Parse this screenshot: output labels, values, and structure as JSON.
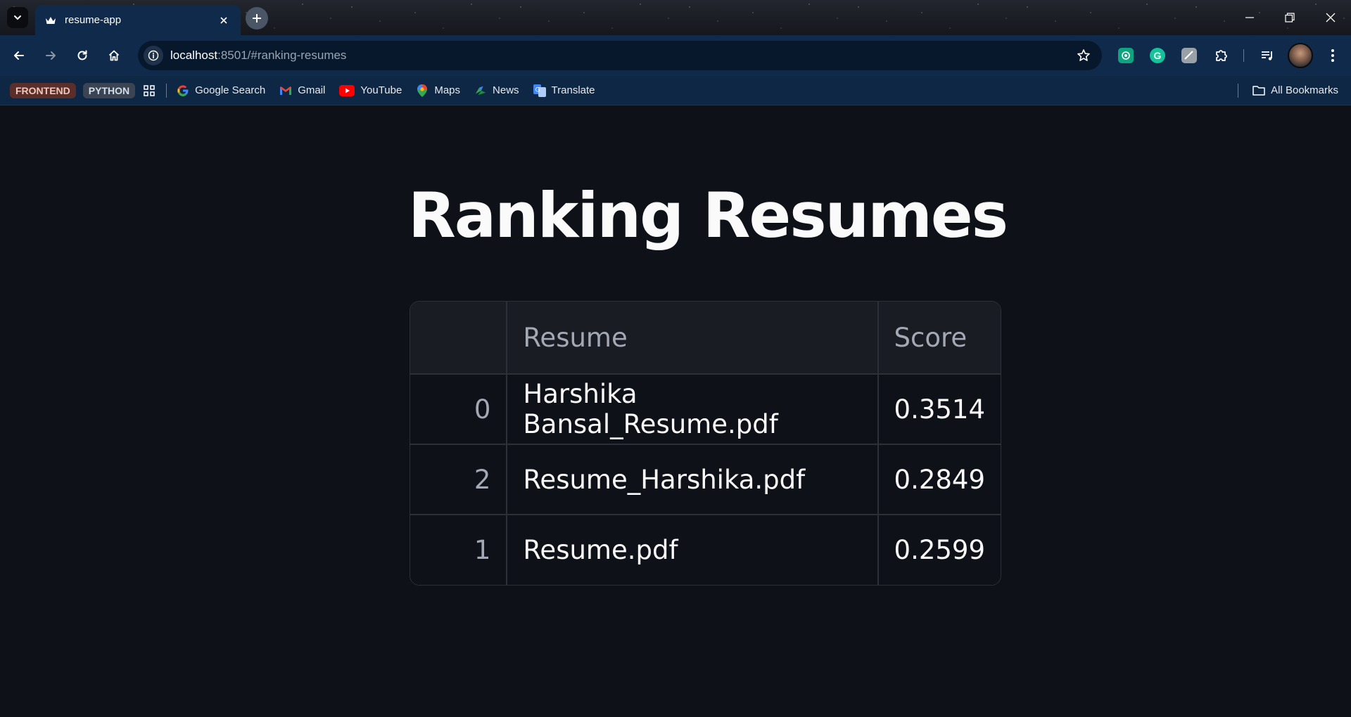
{
  "browser": {
    "tab": {
      "title": "resume-app",
      "favicon": "streamlit-crown-icon"
    },
    "url": {
      "host": "localhost",
      "rest": ":8501/#ranking-resumes"
    },
    "bookmarks": {
      "chips": [
        {
          "label": "FRONTEND",
          "bg": "#5a2e29",
          "color": "#f2c7be"
        },
        {
          "label": "PYTHON",
          "bg": "#3a4452",
          "color": "#d6dde8"
        }
      ],
      "items": [
        {
          "label": "Google Search",
          "icon": "google-icon"
        },
        {
          "label": "Gmail",
          "icon": "gmail-icon"
        },
        {
          "label": "YouTube",
          "icon": "youtube-icon"
        },
        {
          "label": "Maps",
          "icon": "maps-icon"
        },
        {
          "label": "News",
          "icon": "news-icon"
        },
        {
          "label": "Translate",
          "icon": "translate-icon"
        }
      ],
      "all_bookmarks": "All Bookmarks"
    }
  },
  "page": {
    "title": "Ranking Resumes",
    "table": {
      "headers": [
        "",
        "Resume",
        "Score"
      ],
      "rows": [
        {
          "index": "0",
          "resume": "Harshika Bansal_Resume.pdf",
          "score": "0.3514"
        },
        {
          "index": "2",
          "resume": "Resume_Harshika.pdf",
          "score": "0.2849"
        },
        {
          "index": "1",
          "resume": "Resume.pdf",
          "score": "0.2599"
        }
      ]
    }
  },
  "colors": {
    "app_background": "#0e1117",
    "table_header_bg": "#1a1c24",
    "chrome_blue": "#0f2a4a"
  }
}
